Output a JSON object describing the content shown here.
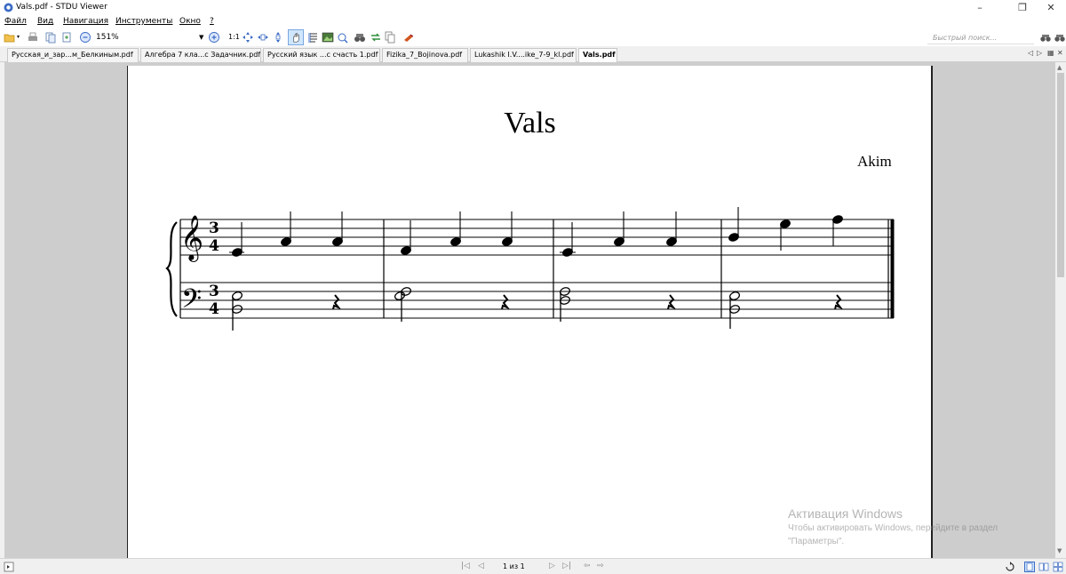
{
  "window": {
    "title": "Vals.pdf - STDU Viewer"
  },
  "window_controls": {
    "minimize": "–",
    "restore": "❐",
    "close": "✕"
  },
  "menu": {
    "items": [
      {
        "label": "Файл"
      },
      {
        "label": "Вид"
      },
      {
        "label": "Навигация"
      },
      {
        "label": "Инструменты"
      },
      {
        "label": "Окно"
      },
      {
        "label": "?"
      }
    ]
  },
  "toolbar": {
    "zoom_value": "151%",
    "search_placeholder": "Быстрый поиск..."
  },
  "tabs": [
    {
      "label": "Русская_и_зар...м_Белкиным.pdf",
      "active": false
    },
    {
      "label": "Алгебра 7 кла...с Задачник.pdf",
      "active": false
    },
    {
      "label": "Русский язык ...с счасть 1.pdf",
      "active": false
    },
    {
      "label": "Fizika_7_Bojinova.pdf",
      "active": false
    },
    {
      "label": "Lukashik I.V....ike_7-9_kl.pdf",
      "active": false
    },
    {
      "label": "Vals.pdf",
      "active": true
    }
  ],
  "tab_controls": {
    "prev": "◁",
    "next": "▷",
    "list": "▦",
    "close": "✕"
  },
  "document": {
    "title": "Vals",
    "composer": "Akim",
    "time_signature": {
      "numerator": "3",
      "denominator": "4"
    }
  },
  "watermark": {
    "line1": "Активация Windows",
    "line2": "Чтобы активировать Windows, перейдите в раздел",
    "line3": "\"Параметры\"."
  },
  "status": {
    "page_indicator": "1 из 1"
  },
  "colors": {
    "viewer_bg": "#cdcdcd",
    "chrome_bg": "#f0f0f0",
    "active_tool": "#cfe6ff"
  }
}
